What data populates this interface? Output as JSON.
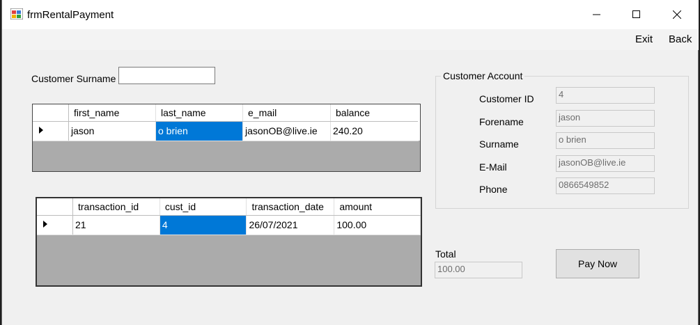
{
  "window": {
    "title": "frmRentalPayment"
  },
  "menu": {
    "exit_label": "Exit",
    "back_label": "Back"
  },
  "search": {
    "label": "Customer Surname",
    "value": ""
  },
  "customer_grid": {
    "columns": [
      "first_name",
      "last_name",
      "e_mail",
      "balance"
    ],
    "rows": [
      [
        "jason",
        "o brien",
        "jasonOB@live.ie",
        "240.20"
      ]
    ]
  },
  "transaction_grid": {
    "columns": [
      "transaction_id",
      "cust_id",
      "transaction_date",
      "amount"
    ],
    "rows": [
      [
        "21",
        "4",
        "26/07/2021",
        "100.00"
      ]
    ]
  },
  "account": {
    "group_title": "Customer Account",
    "customer_id_label": "Customer ID",
    "customer_id": "4",
    "forename_label": "Forename",
    "forename": "jason",
    "surname_label": "Surname",
    "surname": "o brien",
    "email_label": "E-Mail",
    "email": "jasonOB@live.ie",
    "phone_label": "Phone",
    "phone": "0866549852"
  },
  "payment": {
    "total_label": "Total",
    "total": "100.00",
    "pay_button": "Pay Now"
  }
}
